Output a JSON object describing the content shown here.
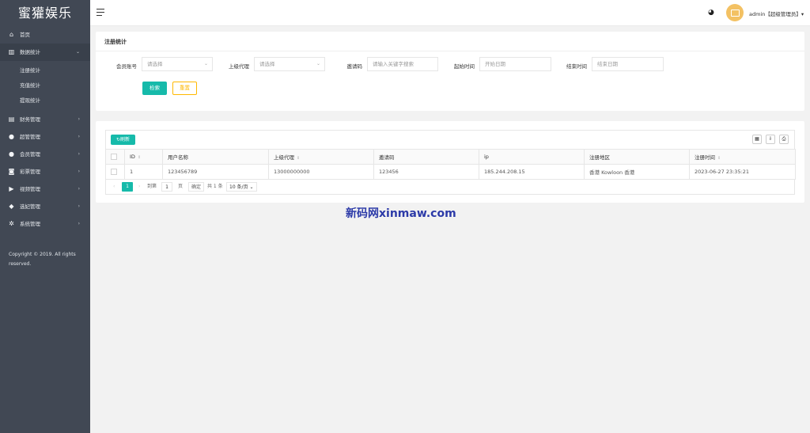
{
  "app": {
    "logo": "蜜獾娱乐"
  },
  "sidebar": {
    "items": [
      {
        "label": "首页",
        "icon": "home-icon",
        "glyph": "⌂"
      },
      {
        "label": "数据统计",
        "icon": "chart-icon",
        "glyph": "▥",
        "caret": "⌄"
      },
      {
        "label": "财务管理",
        "icon": "bank-icon",
        "glyph": "▤",
        "caret": "›"
      },
      {
        "label": "超管管理",
        "icon": "user-icon",
        "glyph": "●",
        "caret": "›"
      },
      {
        "label": "会员管理",
        "icon": "users-icon",
        "glyph": "●",
        "caret": "›"
      },
      {
        "label": "彩票管理",
        "icon": "gamepad-icon",
        "glyph": "◙",
        "caret": "›"
      },
      {
        "label": "视频管理",
        "icon": "video-icon",
        "glyph": "▶",
        "caret": "›"
      },
      {
        "label": "选妃管理",
        "icon": "tag-icon",
        "glyph": "◆",
        "caret": "›"
      },
      {
        "label": "系统管理",
        "icon": "gear-icon",
        "glyph": "✲",
        "caret": "›"
      }
    ],
    "subitems": [
      "注册统计",
      "充值统计",
      "提现统计"
    ],
    "copyright": "Copyright © 2019. All rights reserved."
  },
  "header": {
    "user_label": "admin【超级管理员】▾"
  },
  "filter": {
    "title": "注册统计",
    "fields": [
      {
        "label": "会员账号",
        "placeholder": "请选择"
      },
      {
        "label": "上级代理",
        "placeholder": "请选择"
      },
      {
        "label": "邀请码",
        "placeholder": "请输入关键字搜索"
      },
      {
        "label": "起始时间",
        "placeholder": "开始日期"
      },
      {
        "label": "结束时间",
        "placeholder": "结束日期"
      }
    ],
    "search_label": "检索",
    "reset_label": "重置"
  },
  "table": {
    "refresh_label": "刷新",
    "columns": [
      "ID",
      "用户名称",
      "上级代理",
      "邀请码",
      "ip",
      "注册地区",
      "注册时间"
    ],
    "rows": [
      [
        "1",
        "123456789",
        "13000000000",
        "123456",
        "185.244.208.15",
        "香港 Kowloon 香港",
        "2023-06-27 23:35:21"
      ]
    ],
    "pager": {
      "prev": "‹",
      "current": "1",
      "next": "›",
      "goto_label": "到第",
      "goto_value": "1",
      "page_unit": "页",
      "confirm": "确定",
      "total": "共 1 条",
      "per_page": "10 条/页 ⌄"
    }
  },
  "watermark": "新码网xinmaw.com",
  "colors": {
    "sidebar": "#414854",
    "primary": "#16baaa",
    "warn": "#ffb800",
    "avatar": "#f3c163"
  }
}
